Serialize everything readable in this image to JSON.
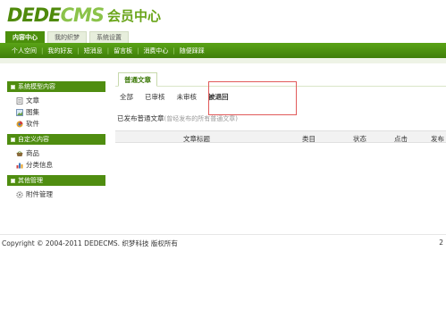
{
  "header": {
    "brand_main": "DEDE",
    "brand_accent": "CMS",
    "subtitle": "会员中心"
  },
  "top_tabs": [
    {
      "label": "内容中心",
      "active": true
    },
    {
      "label": "我的织梦",
      "active": false
    },
    {
      "label": "系统设置",
      "active": false
    }
  ],
  "nav": {
    "items": [
      "个人空间",
      "我的好友",
      "短消息",
      "留言板",
      "消费中心",
      "随便踩踩"
    ]
  },
  "sidebar": {
    "sections": [
      {
        "title": "系统模型内容",
        "items": [
          {
            "label": "文章",
            "icon": "document-icon"
          },
          {
            "label": "图集",
            "icon": "picture-icon"
          },
          {
            "label": "软件",
            "icon": "software-icon"
          }
        ]
      },
      {
        "title": "自定义内容",
        "items": [
          {
            "label": "商品",
            "icon": "shopping-basket-icon"
          },
          {
            "label": "分类信息",
            "icon": "bar-chart-icon"
          }
        ]
      },
      {
        "title": "其他管理",
        "items": [
          {
            "label": "附件管理",
            "icon": "gear-icon"
          }
        ]
      }
    ]
  },
  "main": {
    "article_tab": "普通文章",
    "filters": [
      "全部",
      "已审核",
      "未审核",
      "被退回"
    ],
    "active_filter": "被退回",
    "published_label": "已发布普通文章",
    "published_hint": "(曾经发布的所有普通文章)",
    "columns": [
      "文章标题",
      "类目",
      "状态",
      "点击",
      "发布"
    ]
  },
  "footer": {
    "copyright": "Copyright © 2004-2011 DEDECMS. 织梦科技 版权所有",
    "right_text": "2"
  },
  "colors": {
    "brand_green": "#4b8f0c",
    "highlight_red": "#e15a5a"
  }
}
